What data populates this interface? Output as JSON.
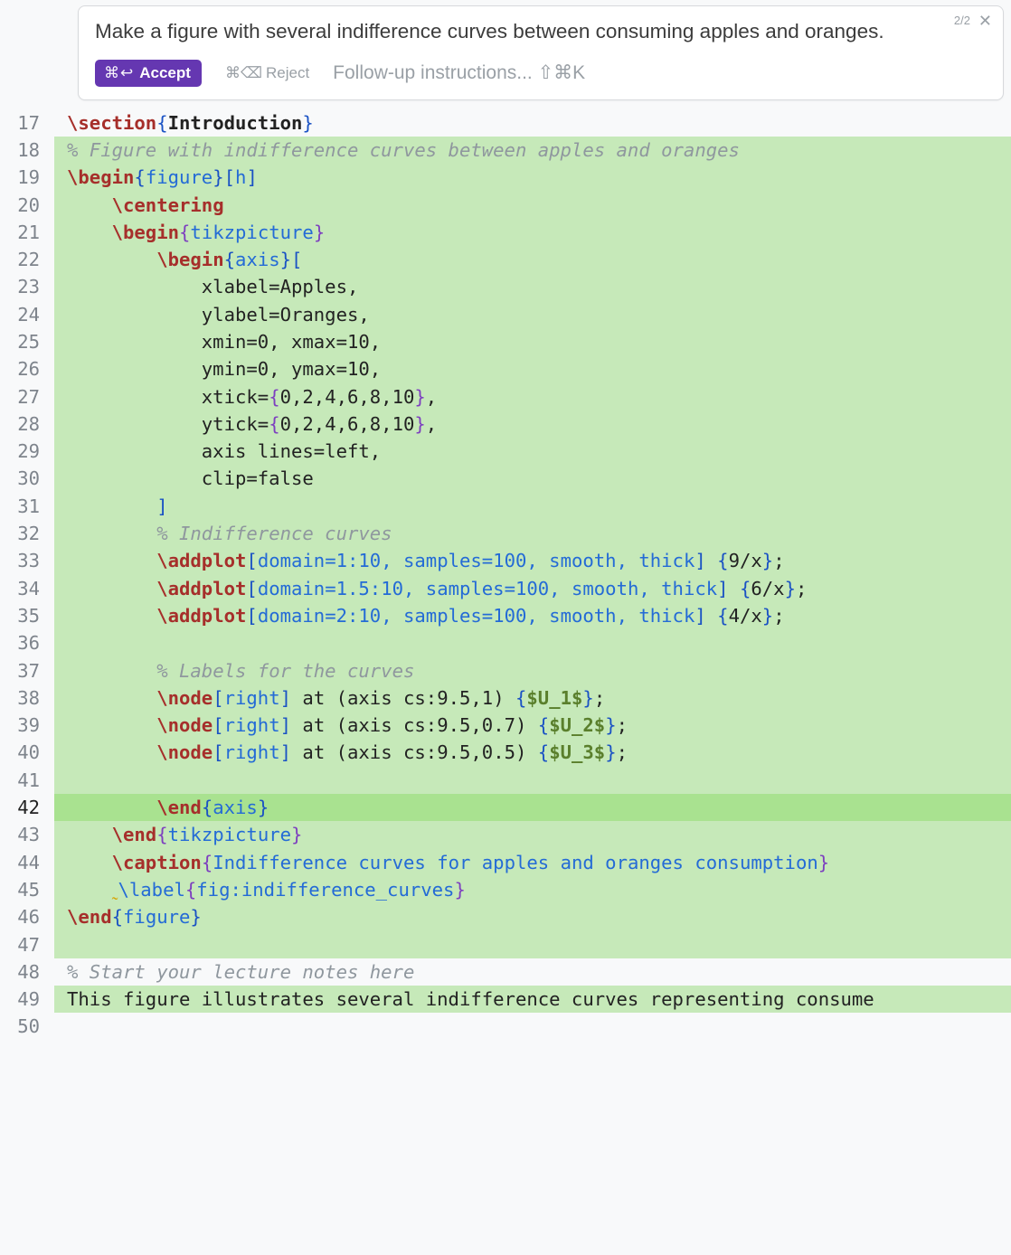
{
  "sugg": {
    "counter": "2/2",
    "prompt": "Make a figure with several indifference curves between consuming apples and oranges.",
    "accept_kb": "⌘↩",
    "accept": "Accept",
    "reject_kb": "⌘⌫",
    "reject": "Reject",
    "followup": "Follow-up instructions... ⇧⌘K"
  },
  "lines": [
    {
      "n": "17",
      "hl": "",
      "seg": [
        [
          "cmd",
          "\\section"
        ],
        [
          "bl",
          "{"
        ],
        [
          "argb",
          "Introduction"
        ],
        [
          "bl",
          "}"
        ]
      ]
    },
    {
      "n": "18",
      "hl": "hl",
      "seg": [
        [
          "comment",
          "% Figure with indifference curves between apples and oranges"
        ]
      ]
    },
    {
      "n": "19",
      "hl": "hl",
      "seg": [
        [
          "cmd",
          "\\begin"
        ],
        [
          "bl",
          "{"
        ],
        [
          "arg",
          "figure"
        ],
        [
          "bl",
          "}"
        ],
        [
          "bl",
          "["
        ],
        [
          "arg",
          "h"
        ],
        [
          "bl",
          "]"
        ]
      ]
    },
    {
      "n": "20",
      "hl": "hl",
      "seg": [
        [
          "plain",
          "    "
        ],
        [
          "cmd",
          "\\centering"
        ]
      ]
    },
    {
      "n": "21",
      "hl": "hl",
      "seg": [
        [
          "plain",
          "    "
        ],
        [
          "cmd",
          "\\begin"
        ],
        [
          "pr",
          "{"
        ],
        [
          "arg",
          "tikzpicture"
        ],
        [
          "pr",
          "}"
        ]
      ]
    },
    {
      "n": "22",
      "hl": "hl",
      "seg": [
        [
          "plain",
          "        "
        ],
        [
          "cmd",
          "\\begin"
        ],
        [
          "bl",
          "{"
        ],
        [
          "arg",
          "axis"
        ],
        [
          "bl",
          "}"
        ],
        [
          "bl",
          "["
        ]
      ]
    },
    {
      "n": "23",
      "hl": "hl",
      "seg": [
        [
          "plain",
          "            xlabel=Apples,"
        ]
      ]
    },
    {
      "n": "24",
      "hl": "hl",
      "seg": [
        [
          "plain",
          "            ylabel=Oranges,"
        ]
      ]
    },
    {
      "n": "25",
      "hl": "hl",
      "seg": [
        [
          "plain",
          "            xmin=0, xmax=10,"
        ]
      ]
    },
    {
      "n": "26",
      "hl": "hl",
      "seg": [
        [
          "plain",
          "            ymin=0, ymax=10,"
        ]
      ]
    },
    {
      "n": "27",
      "hl": "hl",
      "seg": [
        [
          "plain",
          "            xtick="
        ],
        [
          "pr",
          "{"
        ],
        [
          "plain",
          "0,2,4,6,8,10"
        ],
        [
          "pr",
          "}"
        ],
        [
          "plain",
          ","
        ]
      ]
    },
    {
      "n": "28",
      "hl": "hl",
      "seg": [
        [
          "plain",
          "            ytick="
        ],
        [
          "pr",
          "{"
        ],
        [
          "plain",
          "0,2,4,6,8,10"
        ],
        [
          "pr",
          "}"
        ],
        [
          "plain",
          ","
        ]
      ]
    },
    {
      "n": "29",
      "hl": "hl",
      "seg": [
        [
          "plain",
          "            axis lines=left,"
        ]
      ]
    },
    {
      "n": "30",
      "hl": "hl",
      "seg": [
        [
          "plain",
          "            clip=false"
        ]
      ]
    },
    {
      "n": "31",
      "hl": "hl",
      "seg": [
        [
          "plain",
          "        "
        ],
        [
          "bl",
          "]"
        ]
      ]
    },
    {
      "n": "32",
      "hl": "hl",
      "seg": [
        [
          "plain",
          "        "
        ],
        [
          "comment",
          "% Indifference curves"
        ]
      ]
    },
    {
      "n": "33",
      "hl": "hl",
      "seg": [
        [
          "plain",
          "        "
        ],
        [
          "cmd",
          "\\addplot"
        ],
        [
          "bl",
          "["
        ],
        [
          "arg",
          "domain=1:10, samples=100, smooth, thick"
        ],
        [
          "bl",
          "]"
        ],
        [
          "plain",
          " "
        ],
        [
          "bl",
          "{"
        ],
        [
          "plain",
          "9/x"
        ],
        [
          "bl",
          "}"
        ],
        [
          "plain",
          ";"
        ]
      ]
    },
    {
      "n": "34",
      "hl": "hl",
      "seg": [
        [
          "plain",
          "        "
        ],
        [
          "cmd",
          "\\addplot"
        ],
        [
          "bl",
          "["
        ],
        [
          "arg",
          "domain=1.5:10, samples=100, smooth, thick"
        ],
        [
          "bl",
          "]"
        ],
        [
          "plain",
          " "
        ],
        [
          "bl",
          "{"
        ],
        [
          "plain",
          "6/x"
        ],
        [
          "bl",
          "}"
        ],
        [
          "plain",
          ";"
        ]
      ]
    },
    {
      "n": "35",
      "hl": "hl",
      "seg": [
        [
          "plain",
          "        "
        ],
        [
          "cmd",
          "\\addplot"
        ],
        [
          "bl",
          "["
        ],
        [
          "arg",
          "domain=2:10, samples=100, smooth, thick"
        ],
        [
          "bl",
          "]"
        ],
        [
          "plain",
          " "
        ],
        [
          "bl",
          "{"
        ],
        [
          "plain",
          "4/x"
        ],
        [
          "bl",
          "}"
        ],
        [
          "plain",
          ";"
        ]
      ]
    },
    {
      "n": "36",
      "hl": "hl",
      "seg": [
        [
          "plain",
          ""
        ]
      ]
    },
    {
      "n": "37",
      "hl": "hl",
      "seg": [
        [
          "plain",
          "        "
        ],
        [
          "comment",
          "% Labels for the curves"
        ]
      ]
    },
    {
      "n": "38",
      "hl": "hl",
      "seg": [
        [
          "plain",
          "        "
        ],
        [
          "cmd",
          "\\node"
        ],
        [
          "bl",
          "["
        ],
        [
          "arg",
          "right"
        ],
        [
          "bl",
          "]"
        ],
        [
          "plain",
          " at (axis cs:9.5,1) "
        ],
        [
          "bl",
          "{"
        ],
        [
          "str",
          "$U_1$"
        ],
        [
          "bl",
          "}"
        ],
        [
          "plain",
          ";"
        ]
      ]
    },
    {
      "n": "39",
      "hl": "hl",
      "seg": [
        [
          "plain",
          "        "
        ],
        [
          "cmd",
          "\\node"
        ],
        [
          "bl",
          "["
        ],
        [
          "arg",
          "right"
        ],
        [
          "bl",
          "]"
        ],
        [
          "plain",
          " at (axis cs:9.5,0.7) "
        ],
        [
          "bl",
          "{"
        ],
        [
          "str",
          "$U_2$"
        ],
        [
          "bl",
          "}"
        ],
        [
          "plain",
          ";"
        ]
      ]
    },
    {
      "n": "40",
      "hl": "hl",
      "seg": [
        [
          "plain",
          "        "
        ],
        [
          "cmd",
          "\\node"
        ],
        [
          "bl",
          "["
        ],
        [
          "arg",
          "right"
        ],
        [
          "bl",
          "]"
        ],
        [
          "plain",
          " at (axis cs:9.5,0.5) "
        ],
        [
          "bl",
          "{"
        ],
        [
          "str",
          "$U_3$"
        ],
        [
          "bl",
          "}"
        ],
        [
          "plain",
          ";"
        ]
      ]
    },
    {
      "n": "41",
      "hl": "hl",
      "seg": [
        [
          "plain",
          ""
        ]
      ]
    },
    {
      "n": "42",
      "hl": "hl2",
      "cur": true,
      "seg": [
        [
          "plain",
          "        "
        ],
        [
          "cmd",
          "\\end"
        ],
        [
          "bl",
          "{"
        ],
        [
          "arg",
          "axis"
        ],
        [
          "bl",
          "}"
        ]
      ]
    },
    {
      "n": "43",
      "hl": "hl",
      "seg": [
        [
          "plain",
          "    "
        ],
        [
          "cmd",
          "\\end"
        ],
        [
          "pr",
          "{"
        ],
        [
          "arg",
          "tikzpicture"
        ],
        [
          "pr",
          "}"
        ]
      ]
    },
    {
      "n": "44",
      "hl": "hl",
      "seg": [
        [
          "plain",
          "    "
        ],
        [
          "cmd",
          "\\caption"
        ],
        [
          "pr",
          "{"
        ],
        [
          "arg",
          "Indifference curves for apples and oranges consumption"
        ],
        [
          "pr",
          "}"
        ]
      ]
    },
    {
      "n": "45",
      "hl": "hl",
      "seg": [
        [
          "plain",
          "    "
        ],
        [
          "warn",
          "˷"
        ],
        [
          "labelcmd",
          "\\label"
        ],
        [
          "pr",
          "{"
        ],
        [
          "arg",
          "fig:indifference_curves"
        ],
        [
          "pr",
          "}"
        ]
      ]
    },
    {
      "n": "46",
      "hl": "hl",
      "seg": [
        [
          "cmd",
          "\\end"
        ],
        [
          "bl",
          "{"
        ],
        [
          "arg",
          "figure"
        ],
        [
          "bl",
          "}"
        ]
      ]
    },
    {
      "n": "47",
      "hl": "hl",
      "seg": [
        [
          "plain",
          ""
        ]
      ]
    },
    {
      "n": "48",
      "hl": "",
      "seg": [
        [
          "comment",
          "% Start your lecture notes here"
        ]
      ]
    },
    {
      "n": "49",
      "hl": "hl",
      "seg": [
        [
          "plain",
          "This figure illustrates several indifference curves representing consume"
        ]
      ]
    },
    {
      "n": "50",
      "hl": "",
      "seg": [
        [
          "plain",
          ""
        ]
      ]
    }
  ]
}
